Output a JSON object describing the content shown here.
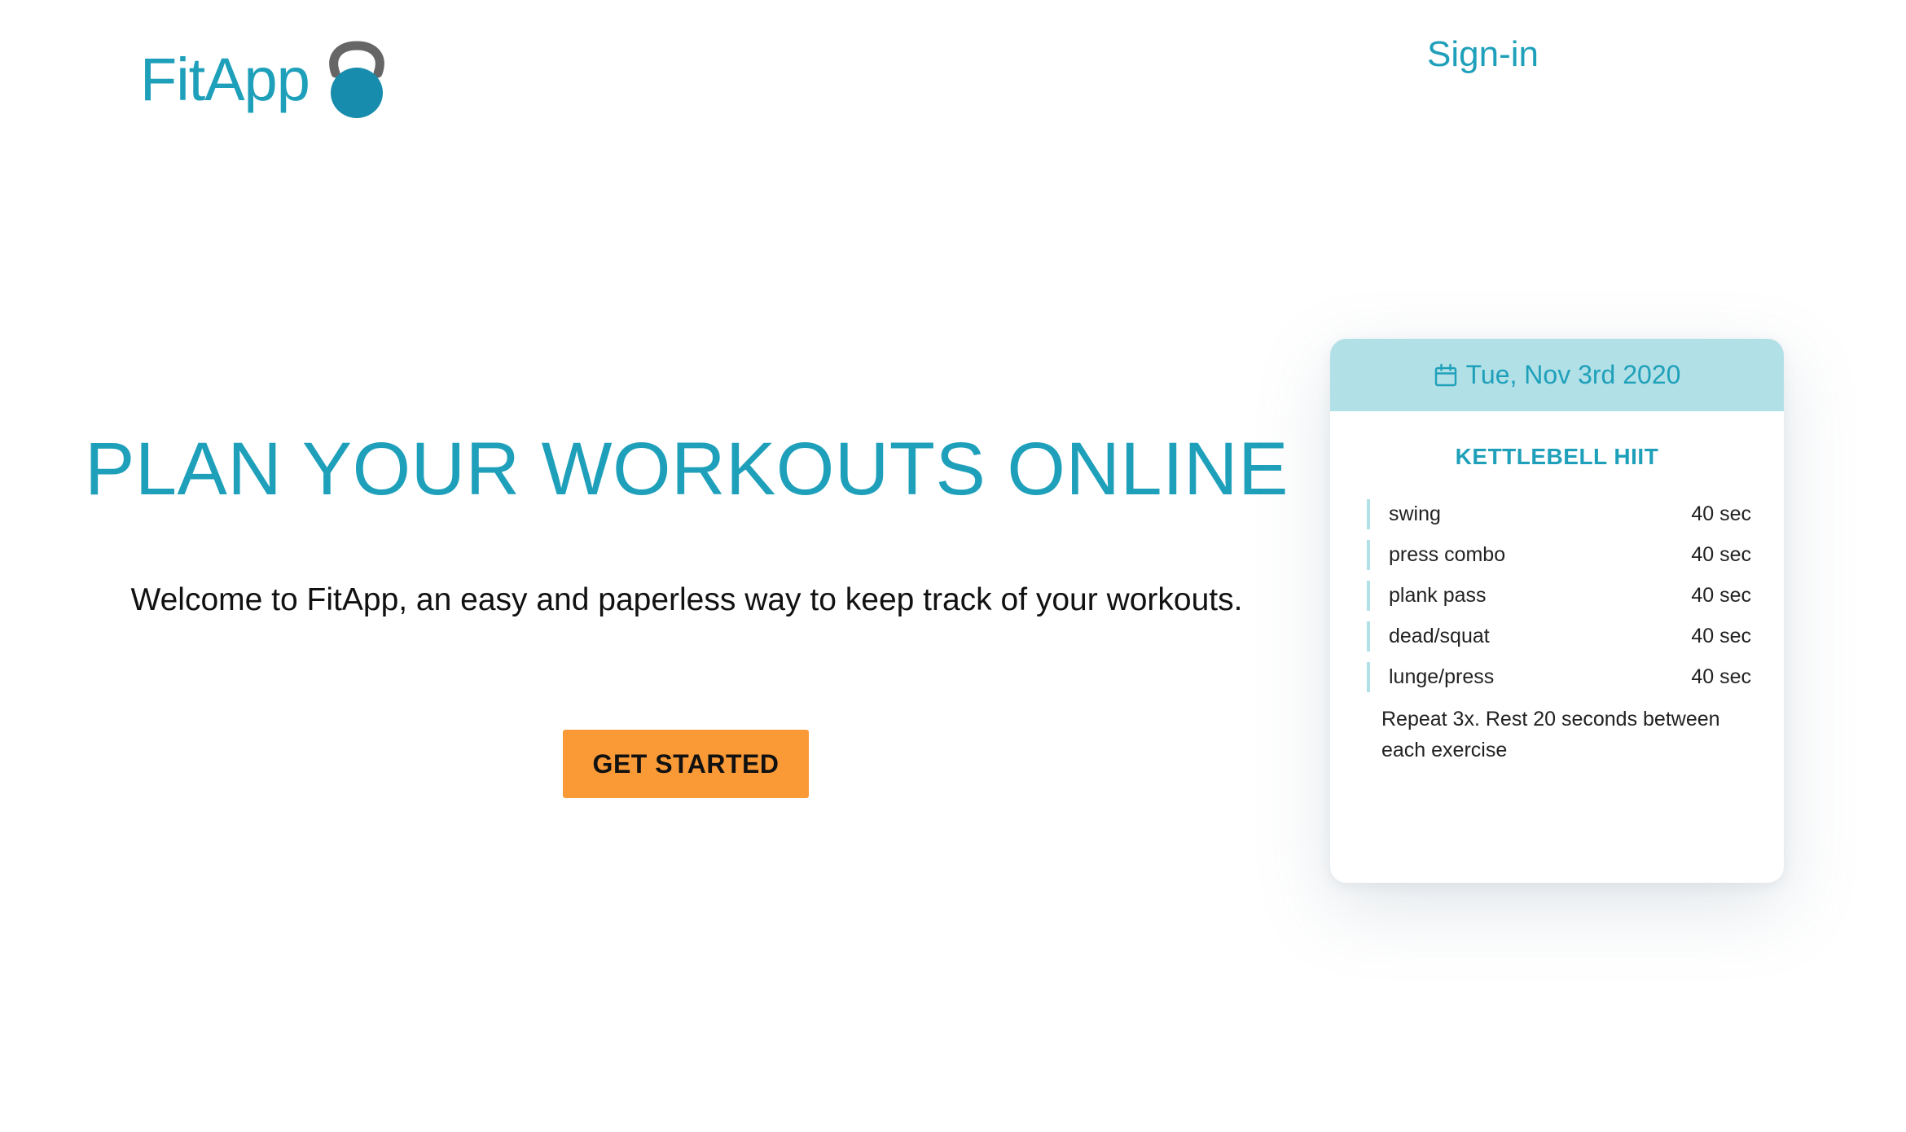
{
  "header": {
    "logo_text": "FitApp",
    "logo_icon": "kettlebell-icon",
    "signin_label": "Sign-in"
  },
  "hero": {
    "title": "PLAN YOUR WORKOUTS ONLINE",
    "subtitle": "Welcome to FitApp, an easy and paperless way to keep track of your workouts.",
    "cta_label": "GET STARTED"
  },
  "card": {
    "date_icon": "calendar-icon",
    "date": "Tue, Nov 3rd 2020",
    "title": "KETTLEBELL HIIT",
    "exercises": [
      {
        "name": "swing",
        "duration": "40 sec"
      },
      {
        "name": "press combo",
        "duration": "40 sec"
      },
      {
        "name": "plank pass",
        "duration": "40 sec"
      },
      {
        "name": "dead/squat",
        "duration": "40 sec"
      },
      {
        "name": "lunge/press",
        "duration": "40 sec"
      }
    ],
    "note": "Repeat 3x. Rest 20 seconds between each exercise"
  },
  "colors": {
    "brand": "#1fa0ba",
    "accent": "#fa9a37",
    "card_header": "#b2e0e7",
    "kettlebell_handle": "#666666",
    "kettlebell_body": "#178cac"
  }
}
